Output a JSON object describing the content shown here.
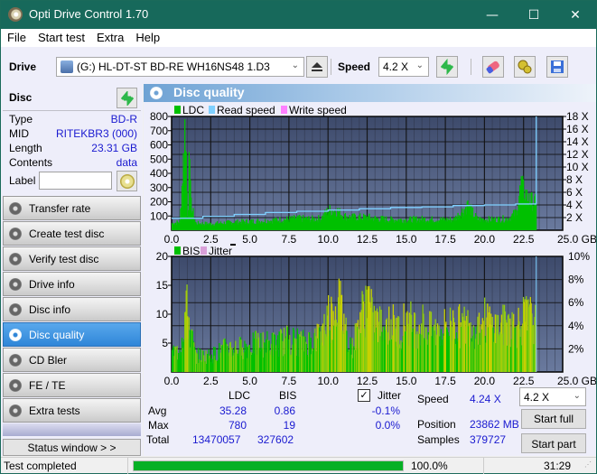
{
  "window": {
    "title": "Opti Drive Control 1.70",
    "controls": {
      "minimize": "—",
      "maximize": "☐",
      "close": "✕"
    }
  },
  "menu": [
    "File",
    "Start test",
    "Extra",
    "Help"
  ],
  "toolbar": {
    "drive_label": "Drive",
    "drive_value": "(G:)  HL-DT-ST BD-RE  WH16NS48 1.D3",
    "speed_label": "Speed",
    "speed_value": "4.2 X",
    "icons": [
      "drive-icon",
      "eject-icon",
      "refresh-icon",
      "eraser-icon",
      "settings-icon",
      "save-icon"
    ]
  },
  "disc": {
    "header": "Disc",
    "rows": [
      {
        "label": "Type",
        "value": "BD-R"
      },
      {
        "label": "MID",
        "value": "RITEKBR3 (000)"
      },
      {
        "label": "Length",
        "value": "23.31 GB"
      },
      {
        "label": "Contents",
        "value": "data"
      }
    ],
    "label_field_label": "Label",
    "label_field_value": ""
  },
  "nav": [
    {
      "label": "Transfer rate",
      "active": false
    },
    {
      "label": "Create test disc",
      "active": false
    },
    {
      "label": "Verify test disc",
      "active": false
    },
    {
      "label": "Drive info",
      "active": false
    },
    {
      "label": "Disc info",
      "active": false
    },
    {
      "label": "Disc quality",
      "active": true
    },
    {
      "label": "CD Bler",
      "active": false
    },
    {
      "label": "FE / TE",
      "active": false
    },
    {
      "label": "Extra tests",
      "active": false
    }
  ],
  "status_window_button": "Status window > >",
  "panel_title": "Disc quality",
  "stats": {
    "col_ldc": "LDC",
    "col_bis": "BIS",
    "jitter_label": "Jitter",
    "jitter_checked": true,
    "rows": [
      {
        "label": "Avg",
        "ldc": "35.28",
        "bis": "0.86",
        "jitter": "-0.1%"
      },
      {
        "label": "Max",
        "ldc": "780",
        "bis": "19",
        "jitter": "0.0%"
      },
      {
        "label": "Total",
        "ldc": "13470057",
        "bis": "327602",
        "jitter": ""
      }
    ],
    "speed_label": "Speed",
    "speed_value": "4.24 X",
    "position_label": "Position",
    "position_value": "23862 MB",
    "samples_label": "Samples",
    "samples_value": "379727",
    "speed_select": "4.2 X",
    "start_full": "Start full",
    "start_part": "Start part"
  },
  "statusbar": {
    "text": "Test completed",
    "progress_percent": 100.0,
    "progress_label": "100.0%",
    "time": "31:29"
  },
  "colors": {
    "plot_bg_top": "#3d4a6b",
    "plot_bg_bottom": "#6a7a9e",
    "ldc": "#00c000",
    "read_speed": "#7fd0ff",
    "write_speed": "#ff80ff",
    "bis": "#00c000",
    "bis_peak": "#c8d000",
    "jitter": "#d8a0d8"
  },
  "chart_data": [
    {
      "type": "bar",
      "title": "LDC / Read speed",
      "legend": [
        "LDC",
        "Read speed",
        "Write speed"
      ],
      "legend_position": "top-left",
      "xlabel": "GB",
      "x_ticks": [
        "0.0",
        "2.5",
        "5.0",
        "7.5",
        "10.0",
        "12.5",
        "15.0",
        "17.5",
        "20.0",
        "22.5",
        "25.0 GB"
      ],
      "xlim": [
        0,
        25
      ],
      "y_ticks_left": [
        "100",
        "200",
        "300",
        "400",
        "500",
        "600",
        "700",
        "800"
      ],
      "ylim_left": [
        0,
        800
      ],
      "y_ticks_right": [
        "2 X",
        "4 X",
        "6 X",
        "8 X",
        "10 X",
        "12 X",
        "14 X",
        "16 X",
        "18 X"
      ],
      "ylim_right": [
        0,
        18
      ],
      "grid": true,
      "ldc_series": {
        "x": [
          0.0,
          0.5,
          0.8,
          0.9,
          1.0,
          1.1,
          1.2,
          1.5,
          2.5,
          4.0,
          5.0,
          6.0,
          7.0,
          8.0,
          9.0,
          9.5,
          10.0,
          10.5,
          11.0,
          11.5,
          12.0,
          12.5,
          13.0,
          14.0,
          15.0,
          16.0,
          17.0,
          18.0,
          18.9,
          19.5,
          20.5,
          21.5,
          22.0,
          22.3,
          22.8,
          23.3
        ],
        "values": [
          60,
          70,
          780,
          550,
          80,
          550,
          230,
          60,
          55,
          70,
          75,
          80,
          90,
          100,
          95,
          100,
          170,
          170,
          120,
          110,
          110,
          110,
          100,
          90,
          90,
          95,
          90,
          90,
          210,
          95,
          90,
          100,
          150,
          380,
          260,
          230
        ]
      },
      "read_speed_series": {
        "x": [
          0,
          2,
          4,
          6,
          8,
          10,
          12,
          14,
          16,
          18,
          20,
          22,
          23.3,
          23.31
        ],
        "values": [
          1.9,
          2.2,
          2.5,
          2.8,
          3.0,
          3.2,
          3.4,
          3.6,
          3.7,
          3.9,
          4.0,
          4.15,
          4.24,
          18
        ]
      }
    },
    {
      "type": "bar",
      "title": "BIS / Jitter",
      "legend": [
        "BIS",
        "Jitter"
      ],
      "legend_position": "top-left",
      "xlabel": "GB",
      "x_ticks": [
        "0.0",
        "2.5",
        "5.0",
        "7.5",
        "10.0",
        "12.5",
        "15.0",
        "17.5",
        "20.0",
        "22.5",
        "25.0 GB"
      ],
      "xlim": [
        0,
        25
      ],
      "y_ticks_left": [
        "5",
        "10",
        "15",
        "20"
      ],
      "ylim_left": [
        0,
        20
      ],
      "y_ticks_right": [
        "2%",
        "4%",
        "6%",
        "8%",
        "10%"
      ],
      "ylim_right": [
        0,
        10
      ],
      "grid": true,
      "bis_series": {
        "x": [
          0.0,
          0.5,
          0.9,
          1.1,
          1.5,
          2.5,
          3.5,
          4.5,
          5.5,
          6.5,
          7.5,
          8.5,
          9.5,
          10.0,
          10.3,
          10.6,
          11.0,
          11.5,
          12.0,
          12.5,
          12.8,
          13.0,
          13.5,
          14.0,
          14.5,
          15.0,
          15.5,
          16.0,
          16.5,
          17.0,
          17.5,
          18.0,
          18.5,
          19.0,
          19.5,
          20.0,
          20.5,
          21.0,
          21.5,
          22.0,
          22.5,
          23.0,
          23.3
        ],
        "values": [
          5,
          5,
          16,
          11,
          4,
          4,
          6,
          6,
          7,
          7,
          8,
          7,
          9,
          14,
          14,
          18,
          12,
          6,
          12,
          19,
          13,
          12,
          11,
          12,
          10,
          13,
          11,
          12,
          10,
          10,
          11,
          12,
          11,
          12,
          11,
          13,
          11,
          11,
          12,
          11,
          13,
          13,
          11
        ]
      }
    }
  ]
}
